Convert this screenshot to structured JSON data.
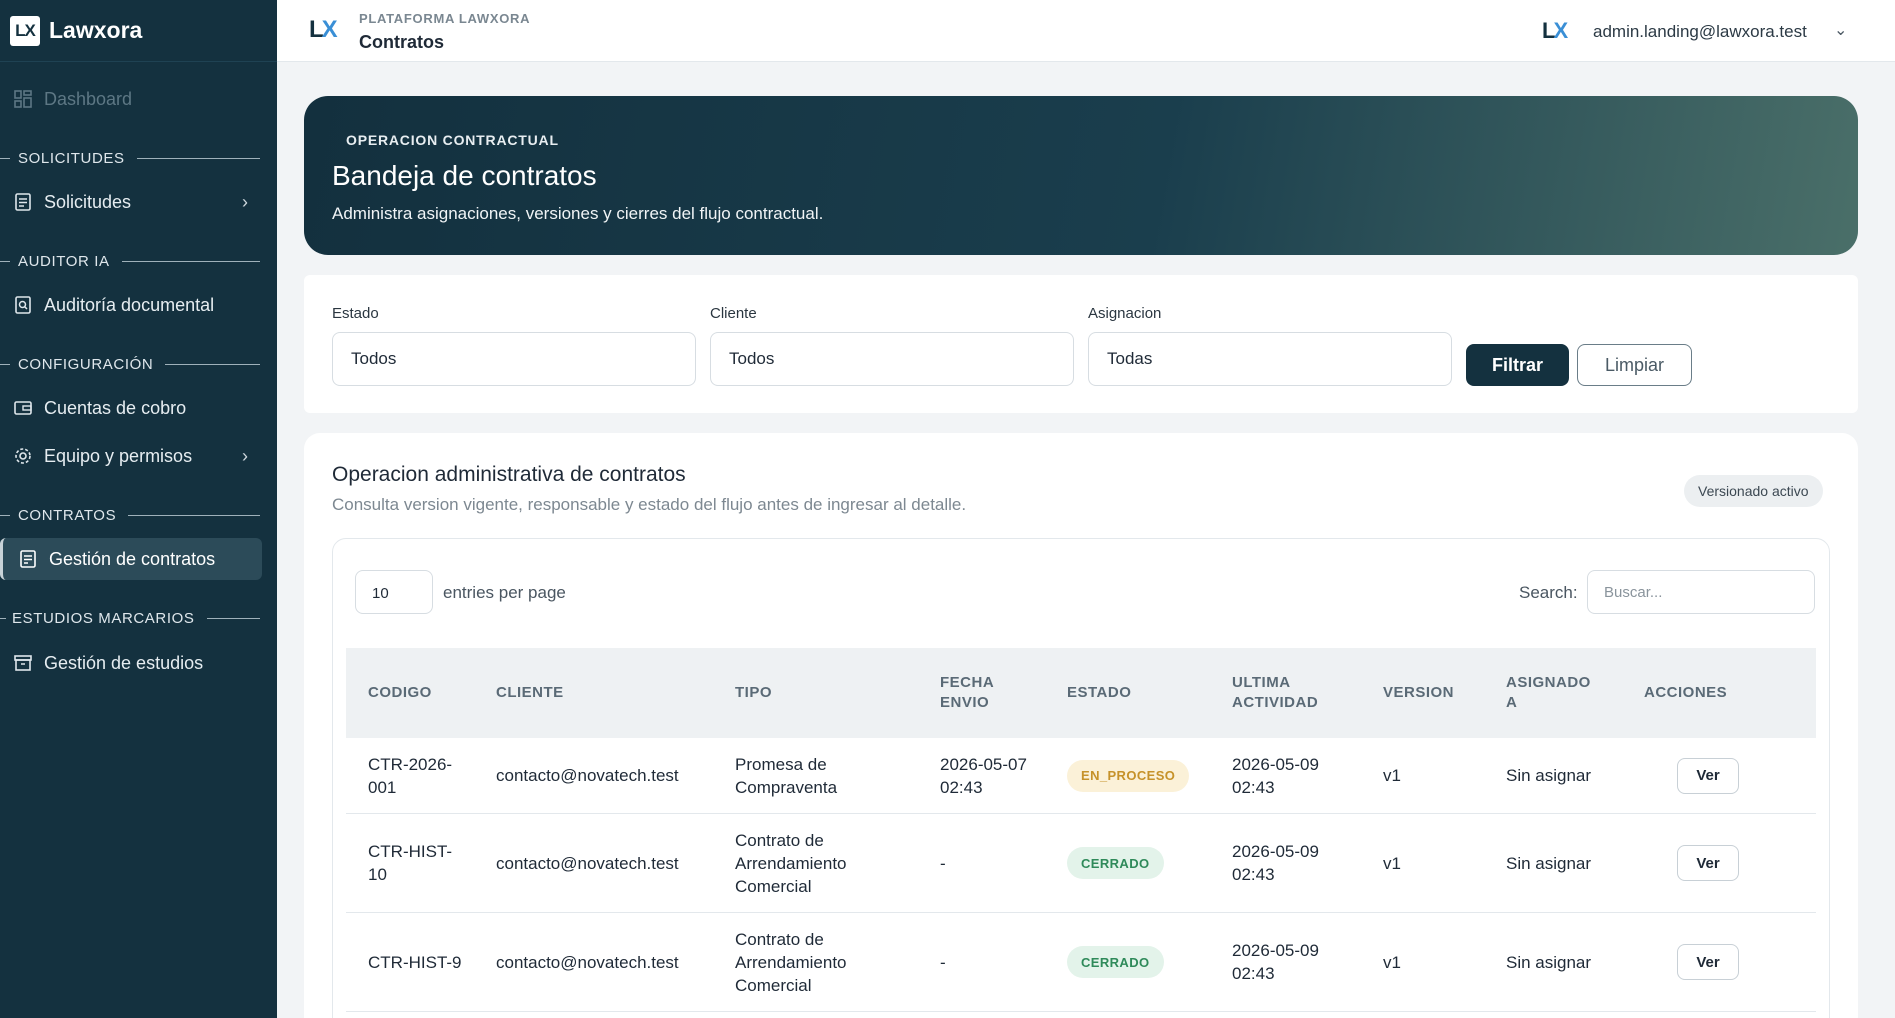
{
  "sidebar": {
    "brand": "Lawxora",
    "brand_mark": "LX",
    "items": {
      "dashboard": "Dashboard",
      "solicitudes": "Solicitudes",
      "auditoria": "Auditoría documental",
      "cuentas": "Cuentas de cobro",
      "equipo": "Equipo y permisos",
      "contratos": "Gestión de contratos",
      "estudios": "Gestión de estudios"
    },
    "sections": {
      "solicitudes": "SOLICITUDES",
      "auditor": "AUDITOR IA",
      "configuracion": "CONFIGURACIÓN",
      "contratos": "CONTRATOS",
      "estudios": "ESTUDIOS MARCARIOS"
    }
  },
  "topbar": {
    "kicker": "PLATAFORMA LAWXORA",
    "title": "Contratos",
    "user_email": "admin.landing@lawxora.test"
  },
  "hero": {
    "kicker": "OPERACION CONTRACTUAL",
    "title": "Bandeja de contratos",
    "subtitle": "Administra asignaciones, versiones y cierres del flujo contractual."
  },
  "filters": {
    "estado_label": "Estado",
    "estado_value": "Todos",
    "cliente_label": "Cliente",
    "cliente_value": "Todos",
    "asignacion_label": "Asignacion",
    "asignacion_value": "Todas",
    "filter_button": "Filtrar",
    "clear_button": "Limpiar"
  },
  "card": {
    "title": "Operacion administrativa de contratos",
    "subtitle": "Consulta version vigente, responsable y estado del flujo antes de ingresar al detalle.",
    "badge": "Versionado activo",
    "entries_value": "10",
    "entries_label": "entries per page",
    "search_label": "Search:",
    "search_placeholder": "Buscar..."
  },
  "table": {
    "headers": {
      "codigo": "CODIGO",
      "cliente": "CLIENTE",
      "tipo": "TIPO",
      "fecha": "FECHA ENVIO",
      "estado": "ESTADO",
      "ultima": "ULTIMA ACTIVIDAD",
      "version": "VERSION",
      "asignado": "ASIGNADO A",
      "acciones": "ACCIONES"
    },
    "rows": [
      {
        "codigo": "CTR-2026-001",
        "cliente": "contacto@novatech.test",
        "tipo": "Promesa de Compraventa",
        "fecha": "2026-05-07 02:43",
        "estado": "EN_PROCESO",
        "ultima": "2026-05-09 02:43",
        "version": "v1",
        "asignado": "Sin asignar",
        "accion": "Ver"
      },
      {
        "codigo": "CTR-HIST-10",
        "cliente": "contacto@novatech.test",
        "tipo": "Contrato de Arrendamiento Comercial",
        "fecha": "-",
        "estado": "CERRADO",
        "ultima": "2026-05-09 02:43",
        "version": "v1",
        "asignado": "Sin asignar",
        "accion": "Ver"
      },
      {
        "codigo": "CTR-HIST-9",
        "cliente": "contacto@novatech.test",
        "tipo": "Contrato de Arrendamiento Comercial",
        "fecha": "-",
        "estado": "CERRADO",
        "ultima": "2026-05-09 02:43",
        "version": "v1",
        "asignado": "Sin asignar",
        "accion": "Ver"
      }
    ]
  },
  "colors": {
    "sidebar_bg": "#14313f",
    "primary": "#14313f",
    "status_proceso": "#c6922a",
    "status_cerrado": "#2f8a5a"
  },
  "icons": [
    "dashboard-icon",
    "document-icon",
    "search-document-icon",
    "wallet-icon",
    "gear-icon",
    "contract-icon",
    "archive-icon",
    "chevron-right-icon",
    "chevron-down-icon"
  ]
}
